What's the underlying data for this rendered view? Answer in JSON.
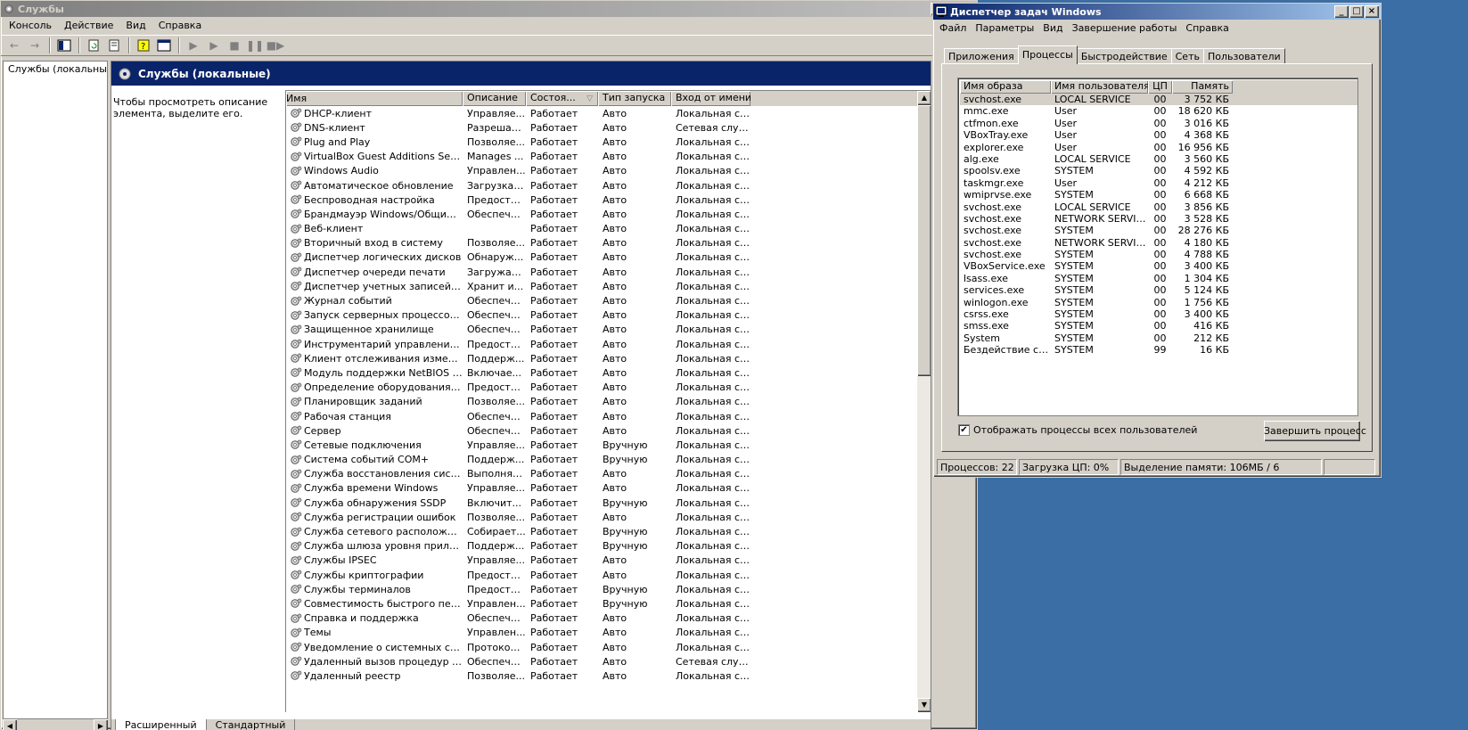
{
  "services_window": {
    "title": "Службы",
    "menu": [
      "Консоль",
      "Действие",
      "Вид",
      "Справка"
    ],
    "tree": {
      "root_label": "Службы (локальные"
    },
    "header_title": "Службы (локальные)",
    "description": "Чтобы просмотреть описание элемента, выделите его.",
    "columns": [
      "Имя",
      "Описание",
      "Состоя...",
      "Тип запуска",
      "Вход от имени"
    ],
    "rows": [
      [
        "DHCP-клиент",
        "Управляе...",
        "Работает",
        "Авто",
        "Локальная сис..."
      ],
      [
        "DNS-клиент",
        "Разрешае...",
        "Работает",
        "Авто",
        "Сетевая служба"
      ],
      [
        "Plug and Play",
        "Позволяе...",
        "Работает",
        "Авто",
        "Локальная сис..."
      ],
      [
        "VirtualBox Guest Additions Service",
        "Manages ...",
        "Работает",
        "Авто",
        "Локальная сис..."
      ],
      [
        "Windows Audio",
        "Управлен...",
        "Работает",
        "Авто",
        "Локальная сис..."
      ],
      [
        "Автоматическое обновление",
        "Загрузка ...",
        "Работает",
        "Авто",
        "Локальная сис..."
      ],
      [
        "Беспроводная настройка",
        "Предоста...",
        "Работает",
        "Авто",
        "Локальная сис..."
      ],
      [
        "Брандмауэр Windows/Общий дост...",
        "Обеспечи...",
        "Работает",
        "Авто",
        "Локальная сис..."
      ],
      [
        "Веб-клиент",
        "",
        "Работает",
        "Авто",
        "Локальная сл..."
      ],
      [
        "Вторичный вход в систему",
        "Позволяе...",
        "Работает",
        "Авто",
        "Локальная сис..."
      ],
      [
        "Диспетчер логических дисков",
        "Обнаруж...",
        "Работает",
        "Авто",
        "Локальная сис..."
      ],
      [
        "Диспетчер очереди печати",
        "Загружае...",
        "Работает",
        "Авто",
        "Локальная сис..."
      ],
      [
        "Диспетчер учетных записей безо...",
        "Хранит и...",
        "Работает",
        "Авто",
        "Локальная сис..."
      ],
      [
        "Журнал событий",
        "Обеспечи...",
        "Работает",
        "Авто",
        "Локальная сис..."
      ],
      [
        "Запуск серверных процессов DCOM",
        "Обеспечи...",
        "Работает",
        "Авто",
        "Локальная сис..."
      ],
      [
        "Защищенное хранилище",
        "Обеспечи...",
        "Работает",
        "Авто",
        "Локальная сис..."
      ],
      [
        "Инструментарий управления Wind...",
        "Предоста...",
        "Работает",
        "Авто",
        "Локальная сис..."
      ],
      [
        "Клиент отслеживания изменивши...",
        "Поддерж...",
        "Работает",
        "Авто",
        "Локальная сис..."
      ],
      [
        "Модуль поддержки NetBIOS через...",
        "Включае...",
        "Работает",
        "Авто",
        "Локальная сл..."
      ],
      [
        "Определение оборудования обол...",
        "Предоста...",
        "Работает",
        "Авто",
        "Локальная сис..."
      ],
      [
        "Планировщик заданий",
        "Позволяе...",
        "Работает",
        "Авто",
        "Локальная сис..."
      ],
      [
        "Рабочая станция",
        "Обеспечи...",
        "Работает",
        "Авто",
        "Локальная сис..."
      ],
      [
        "Сервер",
        "Обеспечи...",
        "Работает",
        "Авто",
        "Локальная сис..."
      ],
      [
        "Сетевые подключения",
        "Управляе...",
        "Работает",
        "Вручную",
        "Локальная сис..."
      ],
      [
        "Система событий COM+",
        "Поддерж...",
        "Работает",
        "Вручную",
        "Локальная сис..."
      ],
      [
        "Служба восстановления системы",
        "Выполняе...",
        "Работает",
        "Авто",
        "Локальная сис..."
      ],
      [
        "Служба времени Windows",
        "Управляе...",
        "Работает",
        "Авто",
        "Локальная сис..."
      ],
      [
        "Служба обнаружения SSDP",
        "Включит...",
        "Работает",
        "Вручную",
        "Локальная сл..."
      ],
      [
        "Служба регистрации ошибок",
        "Позволяе...",
        "Работает",
        "Авто",
        "Локальная сис..."
      ],
      [
        "Служба сетевого расположения (...",
        "Собирает...",
        "Работает",
        "Вручную",
        "Локальная сис..."
      ],
      [
        "Служба шлюза уровня приложения",
        "Поддерж...",
        "Работает",
        "Вручную",
        "Локальная сл..."
      ],
      [
        "Службы IPSEC",
        "Управляе...",
        "Работает",
        "Авто",
        "Локальная сис..."
      ],
      [
        "Службы криптографии",
        "Предоста...",
        "Работает",
        "Авто",
        "Локальная сис..."
      ],
      [
        "Службы терминалов",
        "Предоста...",
        "Работает",
        "Вручную",
        "Локальная сис..."
      ],
      [
        "Совместимость быстрого переклю...",
        "Управлен...",
        "Работает",
        "Вручную",
        "Локальная сис..."
      ],
      [
        "Справка и поддержка",
        "Обеспечи...",
        "Работает",
        "Авто",
        "Локальная сис..."
      ],
      [
        "Темы",
        "Управлен...",
        "Работает",
        "Авто",
        "Локальная сис..."
      ],
      [
        "Уведомление о системных событиях",
        "Протокол...",
        "Работает",
        "Авто",
        "Локальная сис..."
      ],
      [
        "Удаленный вызов процедур (RPC)",
        "Обеспечи...",
        "Работает",
        "Авто",
        "Сетевая служба"
      ],
      [
        "Удаленный реестр",
        "Позволяе...",
        "Работает",
        "Авто",
        "Локальная сл..."
      ]
    ],
    "bottom_tabs": [
      "Расширенный",
      "Стандартный"
    ]
  },
  "task_manager": {
    "title": "Диспетчер задач Windows",
    "menu": [
      "Файл",
      "Параметры",
      "Вид",
      "Завершение работы",
      "Справка"
    ],
    "tabs": [
      "Приложения",
      "Процессы",
      "Быстродействие",
      "Сеть",
      "Пользователи"
    ],
    "selected_tab": "Процессы",
    "columns": [
      "Имя образа",
      "Имя пользователя",
      "ЦП",
      "Память"
    ],
    "processes": [
      [
        "svchost.exe",
        "LOCAL SERVICE",
        "00",
        "3 752 КБ"
      ],
      [
        "mmc.exe",
        "User",
        "00",
        "18 620 КБ"
      ],
      [
        "ctfmon.exe",
        "User",
        "00",
        "3 016 КБ"
      ],
      [
        "VBoxTray.exe",
        "User",
        "00",
        "4 368 КБ"
      ],
      [
        "explorer.exe",
        "User",
        "00",
        "16 956 КБ"
      ],
      [
        "alg.exe",
        "LOCAL SERVICE",
        "00",
        "3 560 КБ"
      ],
      [
        "spoolsv.exe",
        "SYSTEM",
        "00",
        "4 592 КБ"
      ],
      [
        "taskmgr.exe",
        "User",
        "00",
        "4 212 КБ"
      ],
      [
        "wmiprvse.exe",
        "SYSTEM",
        "00",
        "6 668 КБ"
      ],
      [
        "svchost.exe",
        "LOCAL SERVICE",
        "00",
        "3 856 КБ"
      ],
      [
        "svchost.exe",
        "NETWORK SERVICE",
        "00",
        "3 528 КБ"
      ],
      [
        "svchost.exe",
        "SYSTEM",
        "00",
        "28 276 КБ"
      ],
      [
        "svchost.exe",
        "NETWORK SERVICE",
        "00",
        "4 180 КБ"
      ],
      [
        "svchost.exe",
        "SYSTEM",
        "00",
        "4 788 КБ"
      ],
      [
        "VBoxService.exe",
        "SYSTEM",
        "00",
        "3 400 КБ"
      ],
      [
        "lsass.exe",
        "SYSTEM",
        "00",
        "1 304 КБ"
      ],
      [
        "services.exe",
        "SYSTEM",
        "00",
        "5 124 КБ"
      ],
      [
        "winlogon.exe",
        "SYSTEM",
        "00",
        "1 756 КБ"
      ],
      [
        "csrss.exe",
        "SYSTEM",
        "00",
        "3 400 КБ"
      ],
      [
        "smss.exe",
        "SYSTEM",
        "00",
        "416 КБ"
      ],
      [
        "System",
        "SYSTEM",
        "00",
        "212 КБ"
      ],
      [
        "Бездействие сис...",
        "SYSTEM",
        "99",
        "16 КБ"
      ]
    ],
    "show_all_label": "Отображать процессы всех пользователей",
    "show_all_checked": true,
    "end_process_label": "Завершить процесс",
    "status": {
      "processes": "Процессов: 22",
      "cpu": "Загрузка ЦП: 0%",
      "memory": "Выделение памяти: 106МБ / 6"
    }
  },
  "colors": {
    "desktop": "#3a6ea5",
    "active_title": "#0a246a",
    "face": "#d4d0c8"
  }
}
